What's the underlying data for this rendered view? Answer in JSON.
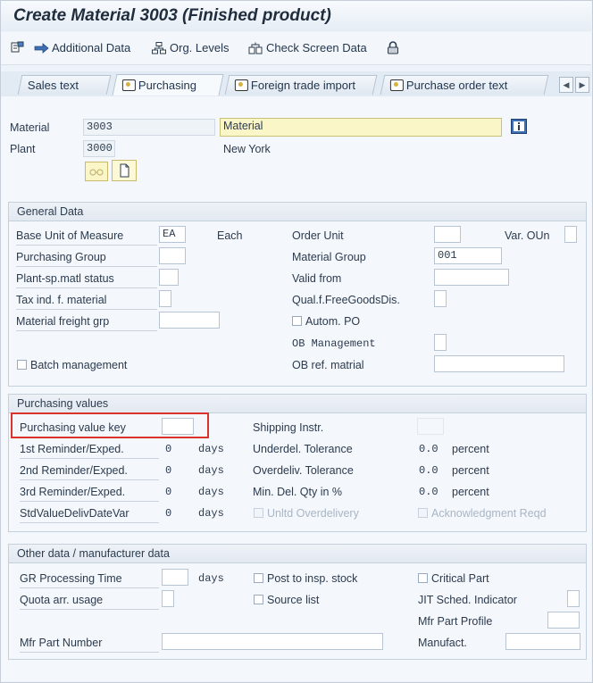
{
  "window": {
    "title": "Create Material 3003 (Finished product)"
  },
  "toolbar": {
    "additional_data": "Additional Data",
    "org_levels": "Org. Levels",
    "check_screen_data": "Check Screen Data"
  },
  "tabs": [
    {
      "label": "Sales text"
    },
    {
      "label": "Purchasing"
    },
    {
      "label": "Foreign trade import"
    },
    {
      "label": "Purchase order text"
    }
  ],
  "header": {
    "material_label": "Material",
    "material_value": "3003",
    "material_desc": "Material",
    "plant_label": "Plant",
    "plant_value": "3000",
    "plant_desc": "New York"
  },
  "general": {
    "title": "General Data",
    "base_uom_label": "Base Unit of Measure",
    "base_uom_value": "EA",
    "base_uom_text": "Each",
    "order_unit_label": "Order Unit",
    "var_oun_label": "Var. OUn",
    "purch_group_label": "Purchasing Group",
    "material_group_label": "Material Group",
    "material_group_value": "001",
    "plant_sp_label": "Plant-sp.matl status",
    "valid_from_label": "Valid from",
    "tax_ind_label": "Tax ind. f. material",
    "qual_free_label": "Qual.f.FreeGoodsDis.",
    "freight_grp_label": "Material freight grp",
    "autom_po_label": "Autom. PO",
    "ob_mgmt_label": "OB Management",
    "batch_mgmt_label": "Batch management",
    "ob_ref_label": "OB ref. matrial"
  },
  "purchasing": {
    "title": "Purchasing values",
    "pvk_label": "Purchasing value key",
    "shipping_label": "Shipping Instr.",
    "r1_label": "1st Reminder/Exped.",
    "r1_value": "0",
    "r2_label": "2nd Reminder/Exped.",
    "r2_value": "0",
    "r3_label": "3rd Reminder/Exped.",
    "r3_value": "0",
    "std_label": "StdValueDelivDateVar",
    "std_value": "0",
    "days": "days",
    "underdel_label": "Underdel. Tolerance",
    "underdel_value": "0.0",
    "overdel_label": "Overdeliv. Tolerance",
    "overdel_value": "0.0",
    "mindel_label": "Min. Del. Qty in %",
    "mindel_value": "0.0",
    "percent": "percent",
    "unltd_label": "Unltd Overdelivery",
    "ack_label": "Acknowledgment Reqd"
  },
  "other": {
    "title": "Other data / manufacturer data",
    "gr_label": "GR Processing Time",
    "days": "days",
    "post_insp_label": "Post to insp. stock",
    "critical_label": "Critical Part",
    "quota_label": "Quota arr. usage",
    "source_list_label": "Source list",
    "jit_label": "JIT Sched. Indicator",
    "mfr_profile_label": "Mfr Part Profile",
    "mfr_part_label": "Mfr Part Number",
    "manufact_label": "Manufact."
  }
}
